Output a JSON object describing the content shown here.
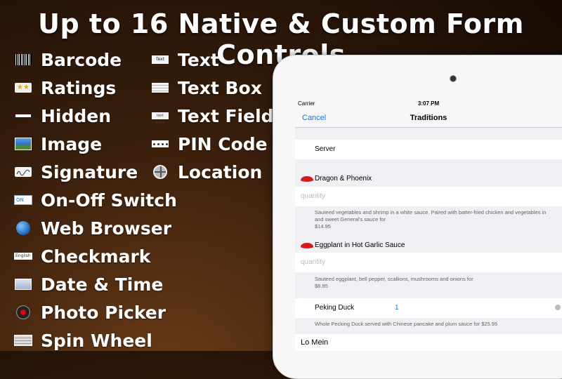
{
  "headline": "Up to 16 Native & Custom Form Controls",
  "features_left": [
    {
      "label": "Barcode",
      "icon": "barcode-icon"
    },
    {
      "label": "Ratings",
      "icon": "star-rating-icon"
    },
    {
      "label": "Hidden",
      "icon": "hidden-icon"
    },
    {
      "label": "Image",
      "icon": "image-icon"
    },
    {
      "label": "Signature",
      "icon": "signature-icon"
    },
    {
      "label": "On-Off Switch",
      "icon": "switch-icon"
    },
    {
      "label": "Web Browser",
      "icon": "globe-icon"
    },
    {
      "label": "Checkmark",
      "icon": "checkmark-icon"
    },
    {
      "label": "Date & Time",
      "icon": "date-time-icon"
    },
    {
      "label": "Photo Picker",
      "icon": "camera-icon"
    },
    {
      "label": "Spin Wheel",
      "icon": "spin-wheel-icon"
    }
  ],
  "features_right": [
    {
      "label": "Text",
      "icon": "text-icon",
      "icon_text": "Text"
    },
    {
      "label": "Text Box",
      "icon": "text-box-icon"
    },
    {
      "label": "Text Field",
      "icon": "text-field-icon",
      "icon_text": "text entry"
    },
    {
      "label": "PIN Code",
      "icon": "pin-code-icon"
    },
    {
      "label": "Location",
      "icon": "location-icon"
    }
  ],
  "icon_texts": {
    "switch": "ON",
    "checkmark": "English"
  },
  "device": {
    "status": {
      "carrier": "Carrier",
      "time": "3:07 PM"
    },
    "nav": {
      "cancel": "Cancel",
      "title": "Traditions"
    },
    "server_label": "Server",
    "items": [
      {
        "name": "Dragon & Phoenix",
        "placeholder": "quantity",
        "desc1": "Sauteed vegetables and shrimp in a white sauce. Paired with batter-fried chicken and vegetables in",
        "desc2": "and sweet General's sauce for",
        "price": "$14.95"
      },
      {
        "name": "Eggplant in Hot Garlic Sauce",
        "placeholder": "quantity",
        "desc1": "Sauteed eggplant, bell pepper, scallions, mushrooms and onions for",
        "price": "$8.95"
      }
    ],
    "peking": {
      "name": "Peking Duck",
      "value": "1",
      "desc": "Whole Pecking Duck served with Chinese pancake and plum sauce for $25.95"
    },
    "lo_mein": "Lo Mein"
  },
  "colors": {
    "accent": "#1a73e8",
    "pepper": "#d41b1b"
  }
}
